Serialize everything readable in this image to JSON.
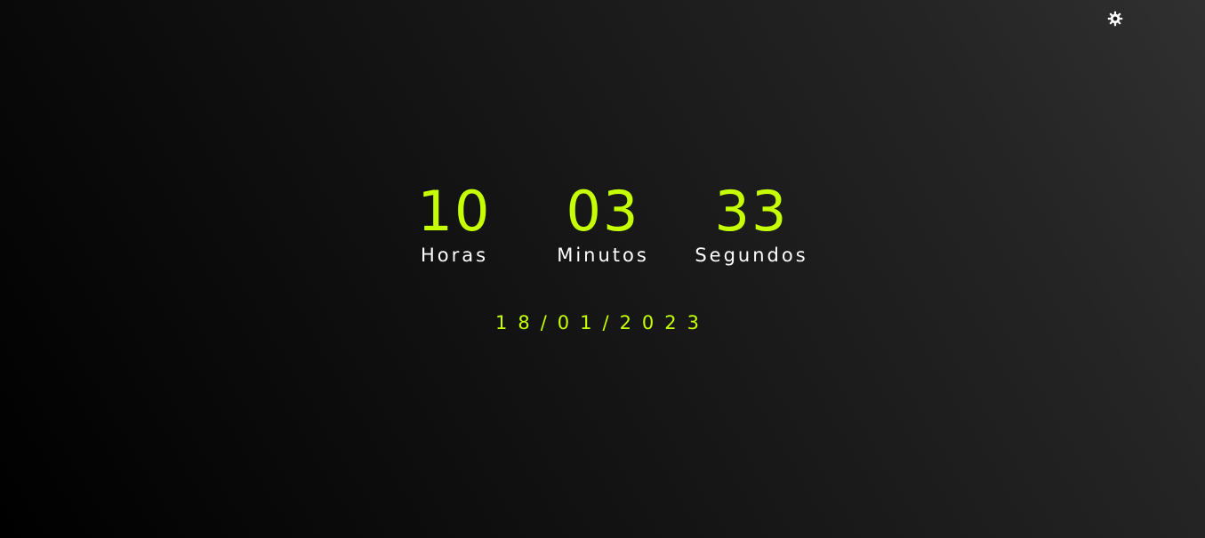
{
  "theme_toggle": {
    "icon": "gear-icon"
  },
  "clock": {
    "hours": {
      "value": "10",
      "label": "Horas"
    },
    "minutes": {
      "value": "03",
      "label": "Minutos"
    },
    "seconds": {
      "value": "33",
      "label": "Segundos"
    }
  },
  "date": "18/01/2023",
  "colors": {
    "accent": "#c6ff00",
    "label": "#ffffff",
    "background_dark": "#000000",
    "background_light": "#303030"
  }
}
